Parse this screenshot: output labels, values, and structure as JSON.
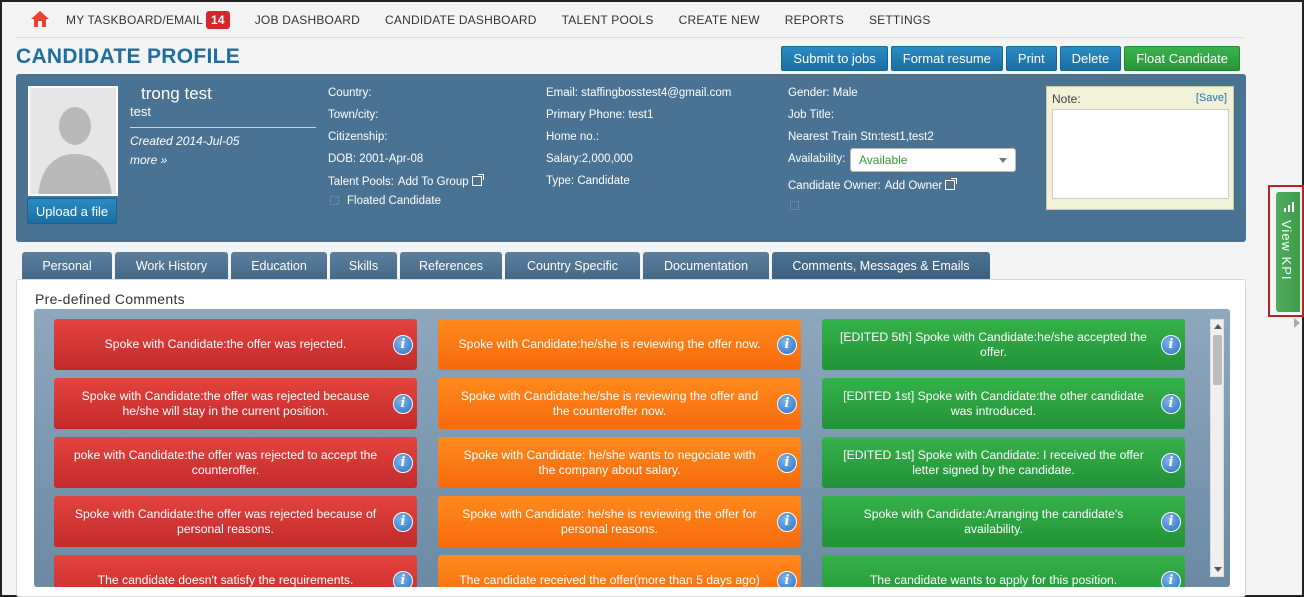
{
  "nav": {
    "items": [
      "MY TASKBOARD/EMAIL",
      "JOB DASHBOARD",
      "CANDIDATE DASHBOARD",
      "TALENT POOLS",
      "CREATE NEW",
      "REPORTS",
      "SETTINGS"
    ],
    "badge": "14"
  },
  "page": {
    "title": "CANDIDATE PROFILE"
  },
  "actions": {
    "submit": "Submit to jobs",
    "format": "Format resume",
    "print": "Print",
    "delete": "Delete",
    "float": "Float Candidate"
  },
  "profile": {
    "name": "trong test",
    "sub": "test",
    "created": "Created 2014-Jul-05",
    "more": "more »",
    "upload": "Upload a file",
    "country": "Country:",
    "town": "Town/city:",
    "citizenship": "Citizenship:",
    "dob": "DOB: 2001-Apr-08",
    "talent_pools_label": "Talent Pools:",
    "talent_pools_link": "Add To Group",
    "floated": "Floated Candidate",
    "email": "Email: staffingbosstest4@gmail.com",
    "phone": "Primary Phone: test1",
    "home": "Home no.:",
    "salary": "Salary:2,000,000",
    "type": "Type:  Candidate",
    "gender": "Gender: Male",
    "job_title": "Job Title:",
    "train": "Nearest Train Stn:test1,test2",
    "availability_label": "Availability:",
    "availability_value": "Available",
    "owner_label": "Candidate Owner:",
    "owner_link": "Add Owner",
    "note_label": "Note:",
    "note_save": "[Save]"
  },
  "tabs": [
    "Personal",
    "Work History",
    "Education",
    "Skills",
    "References",
    "Country Specific",
    "Documentation",
    "Comments, Messages & Emails"
  ],
  "comments": {
    "title": "Pre-defined Comments",
    "red": [
      "Spoke with Candidate:the offer was rejected.",
      "Spoke with Candidate:the offer was rejected because he/she will stay in the current position.",
      "poke with Candidate:the offer was rejected to accept the counteroffer.",
      "Spoke with Candidate:the offer was rejected because of personal reasons.",
      "The candidate doesn't satisfy the requirements."
    ],
    "orange": [
      "Spoke with Candidate:he/she is reviewing the offer now.",
      "Spoke with Candidate:he/she is reviewing the offer and the counteroffer now.",
      "Spoke with Candidate: he/she wants to negociate with the company about salary.",
      "Spoke with Candidate: he/she is reviewing the offer for personal reasons.",
      "The candidate received the offer(more than 5 days ago)"
    ],
    "green": [
      "[EDITED 5th] Spoke with Candidate:he/she accepted the offer.",
      "[EDITED 1st] Spoke with Candidate:the other candidate was introduced.",
      "[EDITED 1st] Spoke with Candidate: I received the offer letter signed by the candidate.",
      "Spoke with Candidate:Arranging the candidate's availability.",
      "The candidate wants to apply for this position."
    ]
  },
  "kpi": {
    "label": "View KPI"
  },
  "colors": {
    "brand": "#1f6e9c",
    "panel": "#4a7393",
    "badge": "#d6262b",
    "kpi": "#4fae5c"
  }
}
